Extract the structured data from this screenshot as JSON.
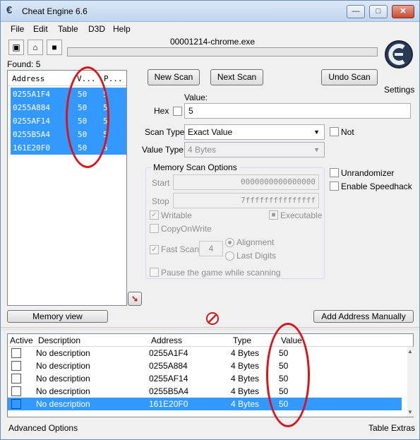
{
  "window": {
    "title": "Cheat Engine 6.6"
  },
  "menu": [
    "File",
    "Edit",
    "Table",
    "D3D",
    "Help"
  ],
  "process": "00001214-chrome.exe",
  "found": "Found: 5",
  "found_list": {
    "headers": [
      "Address",
      "V...",
      "P..."
    ],
    "rows": [
      [
        "0255A1F4",
        "50",
        "5"
      ],
      [
        "0255A884",
        "50",
        "5"
      ],
      [
        "0255AF14",
        "50",
        "5"
      ],
      [
        "0255B5A4",
        "50",
        "5"
      ],
      [
        "161E20F0",
        "50",
        "5"
      ]
    ]
  },
  "buttons": {
    "new_scan": "New Scan",
    "next_scan": "Next Scan",
    "undo_scan": "Undo Scan",
    "memory_view": "Memory view",
    "add_address": "Add Address Manually"
  },
  "settings_label": "Settings",
  "scan": {
    "value_label": "Value:",
    "hex_label": "Hex",
    "value": "5",
    "scan_type_label": "Scan Type",
    "scan_type": "Exact Value",
    "not_label": "Not",
    "value_type_label": "Value Type",
    "value_type": "4 Bytes"
  },
  "memory_options": {
    "title": "Memory Scan Options",
    "start_label": "Start",
    "start": "0000000000000000",
    "stop_label": "Stop",
    "stop": "7fffffffffffffff",
    "writable": "Writable",
    "executable": "Executable",
    "copyonwrite": "CopyOnWrite",
    "fastscan": "Fast Scan",
    "fastscan_value": "4",
    "alignment": "Alignment",
    "last_digits": "Last Digits",
    "pause": "Pause the game while scanning"
  },
  "options_right": {
    "unrandomizer": "Unrandomizer",
    "speedhack": "Enable Speedhack"
  },
  "address_list": {
    "headers": [
      "Active",
      "Description",
      "Address",
      "Type",
      "Value"
    ],
    "rows": [
      [
        "No description",
        "0255A1F4",
        "4 Bytes",
        "50"
      ],
      [
        "No description",
        "0255A884",
        "4 Bytes",
        "50"
      ],
      [
        "No description",
        "0255AF14",
        "4 Bytes",
        "50"
      ],
      [
        "No description",
        "0255B5A4",
        "4 Bytes",
        "50"
      ],
      [
        "No description",
        "161E20F0",
        "4 Bytes",
        "50"
      ]
    ]
  },
  "status": {
    "left": "Advanced Options",
    "right": "Table Extras"
  },
  "colors": {
    "selection": "#3399ff",
    "annotation": "#d9141a"
  }
}
